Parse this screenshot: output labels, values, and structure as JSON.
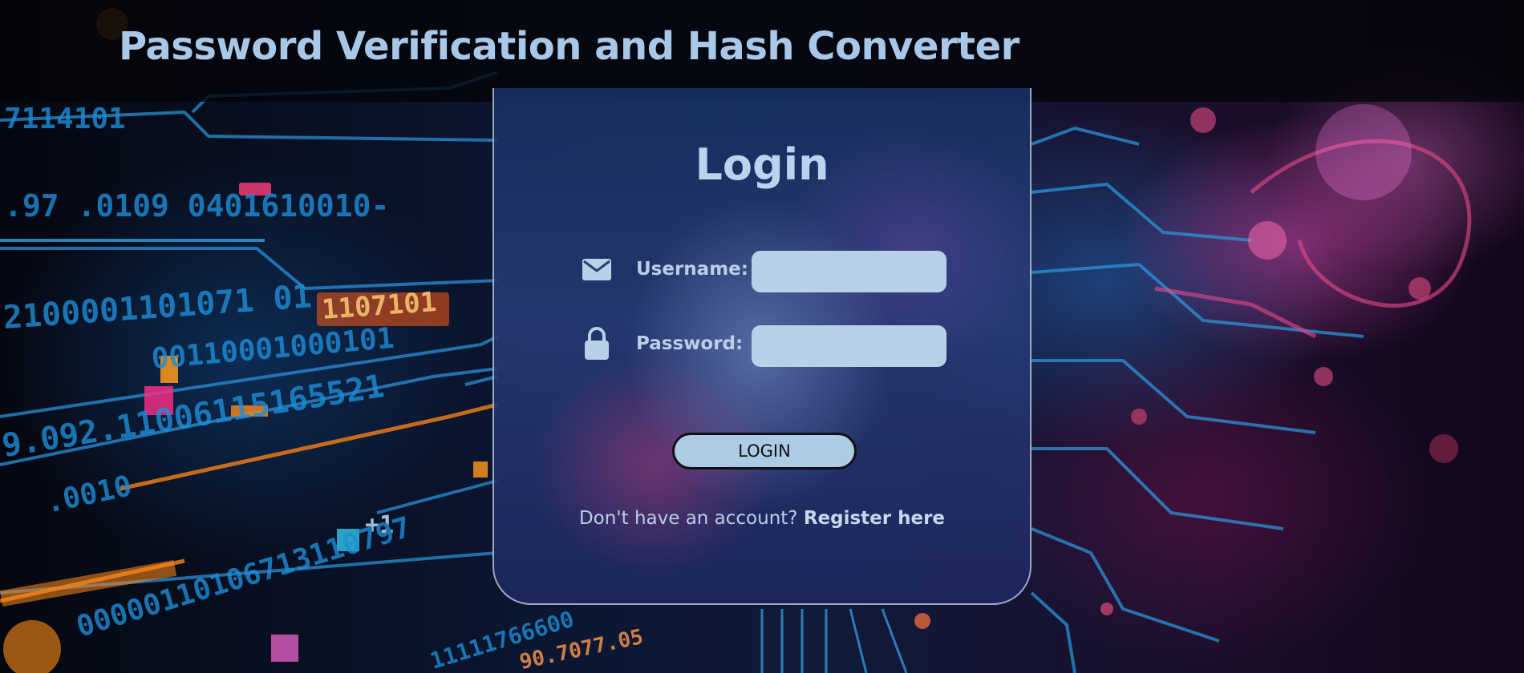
{
  "header": {
    "title": "Password Verification and Hash Converter"
  },
  "login": {
    "heading": "Login",
    "username_label": "Username:",
    "username_value": "",
    "username_icon": "envelope-icon",
    "password_label": "Password:",
    "password_value": "",
    "password_icon": "lock-icon",
    "button_label": "LOGIN",
    "register_prompt": "Don't have an account?",
    "register_link": "Register here"
  },
  "background": {
    "code_text": [
      "7114101",
      ".97 .0109 0401610010-",
      "2100001101071 01",
      "1107101",
      "00110001000101",
      "9.092.11006115165521",
      ".0010",
      "+1",
      "00000110106713110797",
      "11111766600",
      "90.7077.05"
    ]
  },
  "colors": {
    "title": "#a9c8e8",
    "input_bg": "#b8d1e8",
    "button_bg": "#aecbe6",
    "card_border": "#c8d2e6"
  }
}
